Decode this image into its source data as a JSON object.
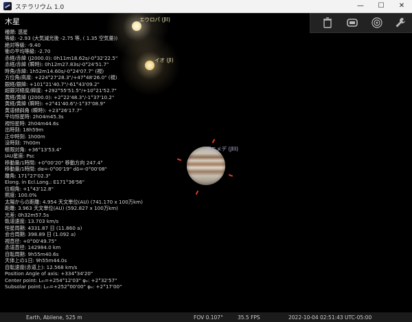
{
  "window": {
    "title": "ステラリウム 1.0",
    "minimize": "—",
    "maximize": "☐",
    "close": "✕"
  },
  "object": {
    "title": "木星",
    "lines": [
      "種類: 惑星",
      "等級: -2.93 (大気減光後 -2.75 等, ( 1.35 空気量))",
      "絶対等級: -9.40",
      "衝の平均等級: -2.70",
      "赤経/赤緯 (J2000.0): 0h11m18.62s/-0°32'22.5\"",
      "赤経/赤緯 (瞬時): 0h12m27.83s/-0°24'51.7\"",
      "時角/赤緯: 1h52m14.60s/-0°24'07.7\" (視)",
      "方位角/高度: +224°27'28.3\"/+47°48'26.0\" (視)",
      "銀経/銀緯: +101°21'40.7\"/-61°43'09.2\"",
      "超銀河経度/緯度: +292°55'51.5\"/+10°21'52.7\"",
      "黄経/黄緯 (J2000.0): +2°22'48.3\"/-1°37'10.2\"",
      "黄経/黄緯 (瞬時): +2°41'40.6\"/-1°37'08.9\"",
      "黄道傾斜角 (瞬時): +23°26'17.7\"",
      "平均恒星時: 2h04m45.3s",
      "視恒星時: 2h04m44.6s",
      "出時刻: 18h59m",
      "正中時刻: 1h00m",
      "没時刻: 7h00m",
      "極限対角: +36°13'53.4\"",
      "IAU星座: Psc",
      "移動量/1時間: +0°00'20\" 移動方向 247.4°",
      "移動量/1時間: dα=-0°00'19\" dδ=-0°00'08\"",
      "離角: 171°27'02.3\"",
      "Elong. in Ecl.Long.: E171°36'56\"",
      "位相角: +1°43'12.8\"",
      "照度: 100.0%",
      "太陽からの距離: 4.954 天文単位(AU) (741.170 x 100万km)",
      "距離: 3.963 天文単位(AU) (592.827 x 100万km)",
      "光差: 0h32m57.5s",
      "軌道速度: 13.703 km/s",
      "恒星周期: 4331.87 日 (11.860 a)",
      "会合周期: 398.89 日 (1.092 a)",
      "視直径: +0°00'49.75\"",
      "赤道直径: 142984.0 km",
      "自転周期: 9h55m40.6s",
      "天体上の1日: 9h55m44.0s",
      "自転速度(赤道上): 12.568 km/s",
      "Position Angle of axis: +334°34'20\"",
      "Center point: Lₘ=+254°12'03\" φₑ: +2°32'57\"",
      "Subsolar point: Lₘ=+252°00'00\" φₑ: +2°17'00\""
    ]
  },
  "moons": [
    {
      "label": "エウロパ (JII)"
    },
    {
      "label": "イオ (JI)"
    },
    {
      "label": "ガニメデ (JIII)"
    }
  ],
  "toolbar": {
    "icons": [
      "trash-icon",
      "screen-icon",
      "network-icon",
      "wrench-icon"
    ]
  },
  "status": {
    "location": "Earth, Abilene, 525 m",
    "fov": "FOV 0.107°",
    "fps": "35.5 FPS",
    "datetime": "2022-10-04 02:51:43 UTC-05:00"
  }
}
